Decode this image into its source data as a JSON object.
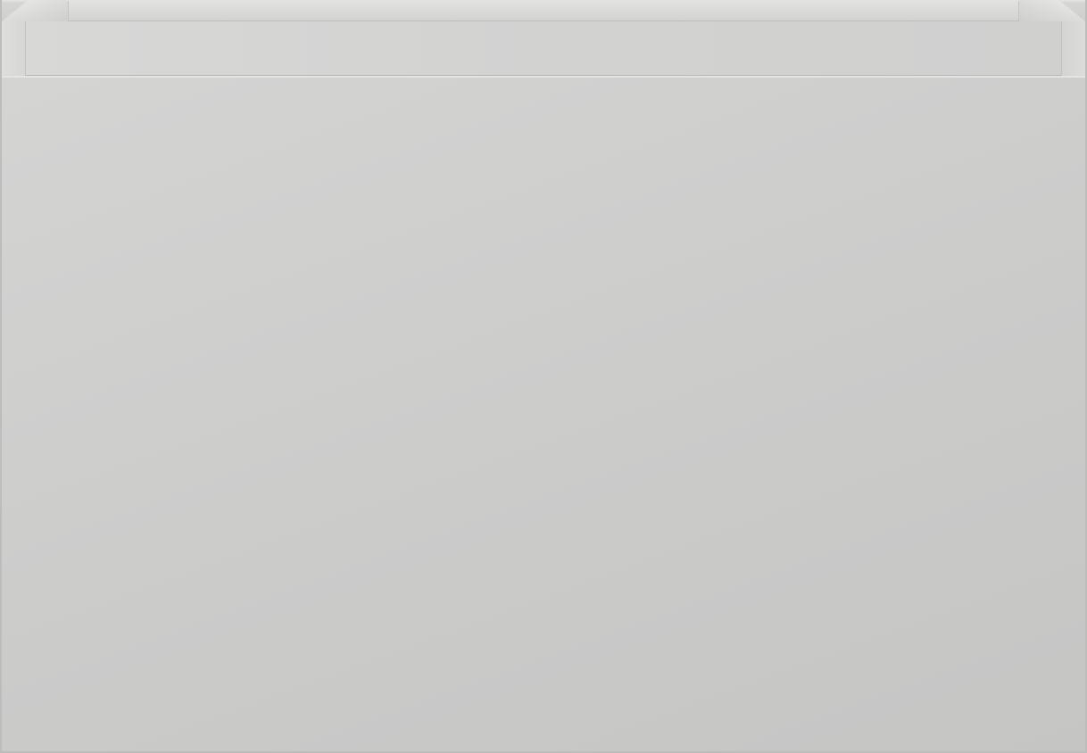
{
  "scene": {
    "subject": "cabinet-drawer-unit",
    "colors": {
      "panel": "#cbcbca",
      "rim": "#d5d5d4",
      "edge": "#bdbdbc"
    }
  }
}
